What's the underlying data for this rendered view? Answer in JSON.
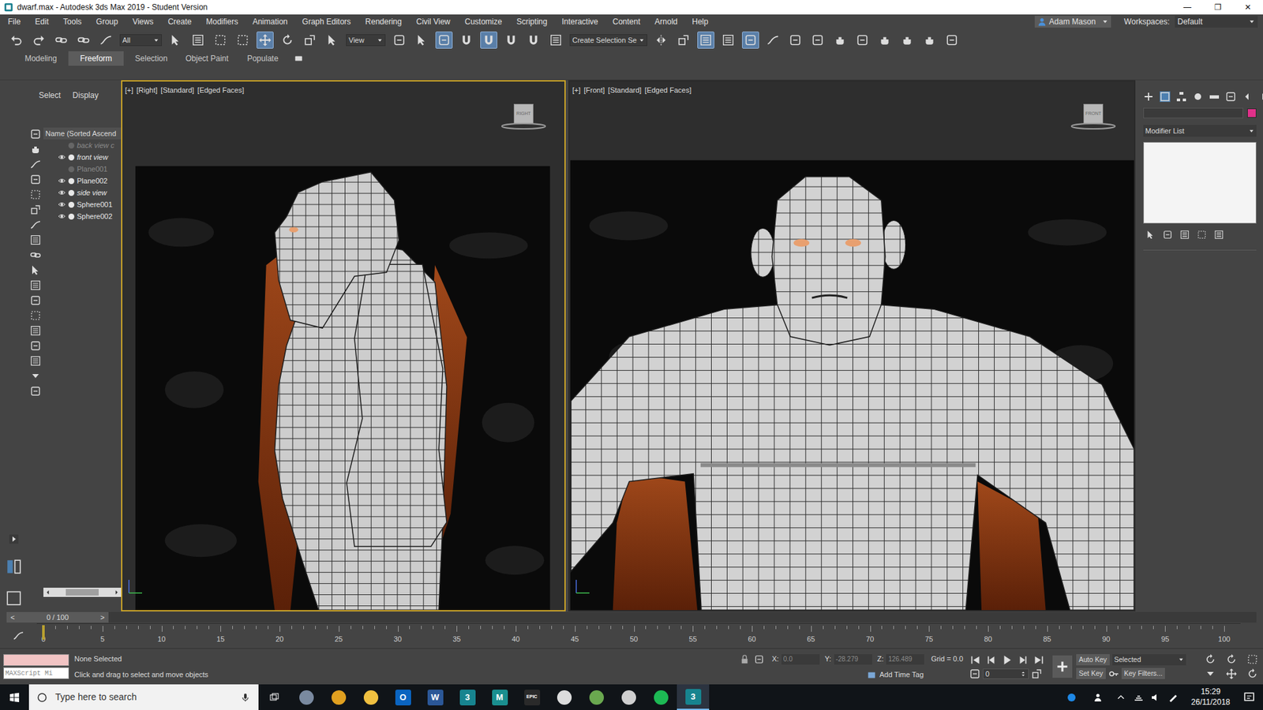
{
  "window": {
    "title": "dwarf.max - Autodesk 3ds Max 2019 - Student Version",
    "controls": [
      "—",
      "❐",
      "✕"
    ]
  },
  "menu": [
    "File",
    "Edit",
    "Tools",
    "Group",
    "Views",
    "Create",
    "Modifiers",
    "Animation",
    "Graph Editors",
    "Rendering",
    "Civil View",
    "Customize",
    "Scripting",
    "Interactive",
    "Content",
    "Arnold",
    "Help"
  ],
  "account": {
    "user": "Adam Mason",
    "workspaces_label": "Workspaces:",
    "workspace": "Default"
  },
  "toolbar": [
    {
      "kind": "tool",
      "active": false
    },
    {
      "kind": "tool",
      "active": false
    },
    {
      "kind": "tool",
      "active": false
    },
    {
      "kind": "tool",
      "active": false
    },
    {
      "kind": "tool",
      "active": false
    },
    {
      "kind": "dropdown",
      "value": "All"
    },
    {
      "kind": "tool",
      "active": false
    },
    {
      "kind": "tool",
      "active": false
    },
    {
      "kind": "tool",
      "active": false
    },
    {
      "kind": "tool",
      "active": false
    },
    {
      "kind": "tool",
      "active": true
    },
    {
      "kind": "tool",
      "active": false
    },
    {
      "kind": "tool",
      "active": false
    },
    {
      "kind": "tool",
      "active": false
    },
    {
      "kind": "dropdown",
      "value": "View"
    },
    {
      "kind": "tool",
      "active": false
    },
    {
      "kind": "tool",
      "active": false
    },
    {
      "kind": "tool",
      "active": true
    },
    {
      "kind": "tool",
      "active": false
    },
    {
      "kind": "tool",
      "active": true
    },
    {
      "kind": "tool",
      "active": false
    },
    {
      "kind": "tool",
      "active": false
    },
    {
      "kind": "tool",
      "active": false
    },
    {
      "kind": "dropdown",
      "value": "Create Selection Se"
    },
    {
      "kind": "tool",
      "active": false
    },
    {
      "kind": "tool",
      "active": false
    },
    {
      "kind": "tool",
      "active": true
    },
    {
      "kind": "tool",
      "active": false
    },
    {
      "kind": "tool",
      "active": true
    },
    {
      "kind": "tool",
      "active": false
    },
    {
      "kind": "tool",
      "active": false
    },
    {
      "kind": "tool",
      "active": false
    },
    {
      "kind": "tool",
      "active": false
    },
    {
      "kind": "tool",
      "active": false
    },
    {
      "kind": "tool",
      "active": false
    },
    {
      "kind": "tool",
      "active": false
    },
    {
      "kind": "tool",
      "active": false
    },
    {
      "kind": "tool",
      "active": false
    }
  ],
  "ribbon_tabs": [
    {
      "label": "Modeling",
      "selected": false
    },
    {
      "label": "Freeform",
      "selected": true
    },
    {
      "label": "Selection",
      "selected": false
    },
    {
      "label": "Object Paint",
      "selected": false
    },
    {
      "label": "Populate",
      "selected": false
    }
  ],
  "explorer": {
    "tabs": [
      "Select",
      "Display"
    ],
    "header": "Name (Sorted Ascend",
    "items": [
      {
        "name": "back view c",
        "visible": false,
        "frozen": true
      },
      {
        "name": "front view",
        "visible": true,
        "frozen": true
      },
      {
        "name": "Plane001",
        "visible": false,
        "frozen": false
      },
      {
        "name": "Plane002",
        "visible": true,
        "frozen": false
      },
      {
        "name": "side view",
        "visible": true,
        "frozen": true
      },
      {
        "name": "Sphere001",
        "visible": true,
        "frozen": false
      },
      {
        "name": "Sphere002",
        "visible": true,
        "frozen": false
      }
    ]
  },
  "viewports": [
    {
      "labels": [
        "[+]",
        "[Right]",
        "[Standard]",
        "[Edged Faces]"
      ],
      "cube": "RIGHT",
      "active": true
    },
    {
      "labels": [
        "[+]",
        "[Front]",
        "[Standard]",
        "[Edged Faces]"
      ],
      "cube": "FRONT",
      "active": false
    }
  ],
  "command_panel": {
    "object_color": "#e0308a",
    "modifier_list": "Modifier List"
  },
  "timeline": {
    "prev": "<",
    "position": "0 / 100",
    "next": ">",
    "level": 0,
    "ticks": [
      "0",
      "5",
      "10",
      "15",
      "20",
      "25",
      "30",
      "35",
      "40",
      "45",
      "50",
      "55",
      "60",
      "65",
      "70",
      "75",
      "80",
      "85",
      "90",
      "95",
      "100"
    ]
  },
  "status": {
    "maxscript": "MAXScript Mi",
    "selection": "None Selected",
    "prompt": "Click and drag to select and move objects",
    "coords": [
      {
        "label": "X:",
        "value": "0.0",
        "disabled": true
      },
      {
        "label": "Y:",
        "value": "-28.279",
        "disabled": true
      },
      {
        "label": "Z:",
        "value": "126.489",
        "disabled": true
      }
    ],
    "grid": "Grid = 0.0",
    "time_tag": "Add Time Tag"
  },
  "animation": {
    "auto_key": "Auto Key",
    "key_mode": "Selected",
    "set_key": "Set Key",
    "key_filters": "Key Filters...",
    "frame": "0"
  },
  "taskbar": {
    "search": "Type here to search",
    "apps": [
      {
        "kind": "icon",
        "color": "#7a8aa0",
        "active": false
      },
      {
        "kind": "icon",
        "color": "#e0a020",
        "active": false
      },
      {
        "kind": "icon",
        "color": "#f0c040",
        "active": false
      },
      {
        "kind": "letter",
        "glyph": "O",
        "color": "#0a64c0",
        "active": false
      },
      {
        "kind": "letter",
        "glyph": "W",
        "color": "#2b5797",
        "active": false
      },
      {
        "kind": "letter",
        "glyph": "3",
        "color": "#17848f",
        "active": false
      },
      {
        "kind": "letter",
        "glyph": "M",
        "color": "#1a8f8f",
        "active": false
      },
      {
        "kind": "letter",
        "glyph": "EPIC",
        "color": "#2a2a2a",
        "active": false
      },
      {
        "kind": "icon",
        "color": "#dcdcdc",
        "active": false
      },
      {
        "kind": "icon",
        "color": "#6aa84f",
        "active": false
      },
      {
        "kind": "icon",
        "color": "#cfcfcf",
        "active": false
      },
      {
        "kind": "icon",
        "color": "#1db954",
        "active": false
      },
      {
        "kind": "letter",
        "glyph": "3",
        "color": "#17848f",
        "active": true
      }
    ],
    "time": "15:29",
    "date": "26/11/2018"
  }
}
